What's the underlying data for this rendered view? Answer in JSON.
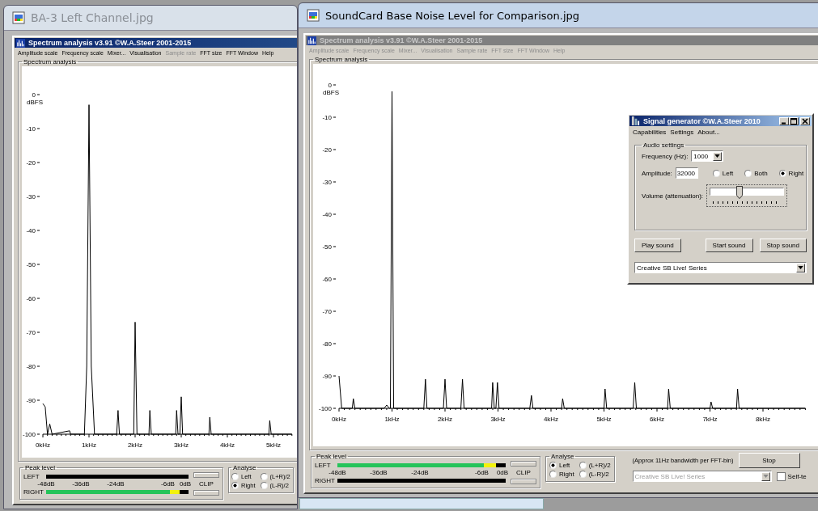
{
  "windows": [
    {
      "title": "BA-3 Left Channel.jpg",
      "active": false,
      "app": {
        "title": "Spectrum analysis v3.91  ©W.A.Steer 2001-2015",
        "active": true,
        "menu": [
          {
            "label": "Amplitude scale",
            "disabled": false
          },
          {
            "label": "Frequency scale",
            "disabled": false
          },
          {
            "label": "Mixer...",
            "disabled": false
          },
          {
            "label": "Visualisation",
            "disabled": false
          },
          {
            "label": "Sample rate",
            "disabled": true
          },
          {
            "label": "FFT size",
            "disabled": false
          },
          {
            "label": "FFT Window",
            "disabled": false
          },
          {
            "label": "Help",
            "disabled": false
          }
        ],
        "group_label": "Spectrum analysis",
        "chart_data": {
          "type": "line",
          "ylabel": "dBFS",
          "xlim": [
            0,
            5.4
          ],
          "ylim": [
            -100,
            0
          ],
          "xticks": [
            {
              "value": 0,
              "label": "0kHz"
            },
            {
              "value": 1,
              "label": "1kHz"
            },
            {
              "value": 2,
              "label": "2kHz"
            },
            {
              "value": 3,
              "label": "3kHz"
            },
            {
              "value": 4,
              "label": "4kHz"
            },
            {
              "value": 5,
              "label": "5kHz"
            }
          ],
          "yticks": [
            {
              "value": 0,
              "label": "0"
            },
            {
              "value": -10,
              "label": "-10"
            },
            {
              "value": -20,
              "label": "-20"
            },
            {
              "value": -30,
              "label": "-30"
            },
            {
              "value": -40,
              "label": "-40"
            },
            {
              "value": -50,
              "label": "-50"
            },
            {
              "value": -60,
              "label": "-60"
            },
            {
              "value": -70,
              "label": "-70"
            },
            {
              "value": -80,
              "label": "-80"
            },
            {
              "value": -90,
              "label": "-90"
            },
            {
              "value": -100,
              "label": "-100"
            }
          ],
          "x": [
            0,
            0.05,
            0.1,
            0.15,
            0.2,
            0.58,
            0.6,
            0.9,
            0.95,
            1.0,
            1.05,
            1.12,
            1.6,
            1.63,
            1.66,
            1.97,
            2.0,
            2.04,
            2.3,
            2.32,
            2.35,
            2.88,
            2.9,
            2.93,
            2.97,
            3.0,
            3.03,
            3.6,
            3.62,
            3.65,
            4.9,
            4.92,
            4.95,
            5.4
          ],
          "series": [
            {
              "color": "#000000",
              "values": [
                -91,
                -92,
                -100,
                -97,
                -100,
                -99,
                -100,
                -100,
                -80,
                -3,
                -80,
                -100,
                -100,
                -93,
                -100,
                -100,
                -67,
                -100,
                -100,
                -93,
                -100,
                -100,
                -93,
                -100,
                -100,
                -89,
                -100,
                -100,
                -95,
                -100,
                -100,
                -96,
                -100,
                -100
              ]
            }
          ]
        },
        "peak_level": {
          "label": "Peak level",
          "meters": [
            {
              "name": "LEFT",
              "level": 0
            },
            {
              "name": "RIGHT",
              "level": 0.94
            }
          ],
          "scale": [
            "-48dB",
            "-36dB",
            "-24dB",
            "-6dB",
            "0dB"
          ],
          "clip_button": "CLIP"
        },
        "analyse": {
          "label": "Analyse",
          "options": [
            {
              "label": "Left",
              "selected": false
            },
            {
              "label": "Right",
              "selected": true
            },
            {
              "label": "(L+R)/2",
              "selected": false
            },
            {
              "label": "(L-R)/2",
              "selected": false
            }
          ]
        }
      }
    },
    {
      "title": "SoundCard Base Noise Level for Comparison.jpg",
      "active": true,
      "app": {
        "title": "Spectrum analysis v3.91  ©W.A.Steer 2001-2015",
        "active": false,
        "menu": [
          {
            "label": "Amplitude scale",
            "disabled": true
          },
          {
            "label": "Frequency scale",
            "disabled": true
          },
          {
            "label": "Mixer...",
            "disabled": true
          },
          {
            "label": "Visualisation",
            "disabled": true
          },
          {
            "label": "Sample rate",
            "disabled": true
          },
          {
            "label": "FFT size",
            "disabled": true
          },
          {
            "label": "FFT Window",
            "disabled": true
          },
          {
            "label": "Help",
            "disabled": true
          }
        ],
        "group_label": "Spectrum analysis",
        "chart_data": {
          "type": "line",
          "ylabel": "dBFS",
          "xlim": [
            0,
            8.8
          ],
          "ylim": [
            -100,
            0
          ],
          "xticks": [
            {
              "value": 0,
              "label": "0kHz"
            },
            {
              "value": 1,
              "label": "1kHz"
            },
            {
              "value": 2,
              "label": "2kHz"
            },
            {
              "value": 3,
              "label": "3kHz"
            },
            {
              "value": 4,
              "label": "4kHz"
            },
            {
              "value": 5,
              "label": "5kHz"
            },
            {
              "value": 6,
              "label": "6kHz"
            },
            {
              "value": 7,
              "label": "7kHz"
            },
            {
              "value": 8,
              "label": "8kHz"
            }
          ],
          "yticks": [
            {
              "value": 0,
              "label": "0"
            },
            {
              "value": -10,
              "label": "-10"
            },
            {
              "value": -20,
              "label": "-20"
            },
            {
              "value": -30,
              "label": "-30"
            },
            {
              "value": -40,
              "label": "-40"
            },
            {
              "value": -50,
              "label": "-50"
            },
            {
              "value": -60,
              "label": "-60"
            },
            {
              "value": -70,
              "label": "-70"
            },
            {
              "value": -80,
              "label": "-80"
            },
            {
              "value": -90,
              "label": "-90"
            },
            {
              "value": -100,
              "label": "-100"
            }
          ],
          "x": [
            0,
            0.05,
            0.25,
            0.27,
            0.3,
            0.85,
            0.9,
            0.95,
            0.97,
            1.0,
            1.03,
            1.1,
            1.6,
            1.63,
            1.66,
            1.97,
            2.0,
            2.03,
            2.3,
            2.33,
            2.36,
            2.88,
            2.9,
            2.93,
            2.96,
            2.99,
            3.02,
            3.6,
            3.63,
            3.66,
            4.2,
            4.22,
            4.25,
            5.0,
            5.02,
            5.05,
            5.55,
            5.58,
            5.61,
            6.2,
            6.22,
            6.25,
            7.0,
            7.02,
            7.05,
            7.5,
            7.52,
            7.55,
            8.8
          ],
          "series": [
            {
              "color": "#000000",
              "values": [
                -90,
                -100,
                -100,
                -97,
                -100,
                -100,
                -99,
                -100,
                -100,
                -2,
                -100,
                -100,
                -100,
                -91,
                -100,
                -100,
                -91,
                -100,
                -100,
                -91,
                -100,
                -100,
                -92,
                -100,
                -100,
                -92,
                -100,
                -100,
                -96,
                -100,
                -100,
                -97,
                -100,
                -100,
                -94,
                -100,
                -100,
                -92,
                -100,
                -100,
                -94,
                -100,
                -100,
                -98,
                -100,
                -100,
                -94,
                -100,
                -100
              ]
            }
          ]
        },
        "peak_level": {
          "label": "Peak level",
          "meters": [
            {
              "name": "LEFT",
              "level": 0.94
            },
            {
              "name": "RIGHT",
              "level": 0
            }
          ],
          "scale": [
            "-48dB",
            "-36dB",
            "-24dB",
            "-6dB",
            "0dB"
          ],
          "clip_button": "CLIP"
        },
        "analyse": {
          "label": "Analyse",
          "options": [
            {
              "label": "Left",
              "selected": true
            },
            {
              "label": "Right",
              "selected": false
            },
            {
              "label": "(L+R)/2",
              "selected": false
            },
            {
              "label": "(L-R)/2",
              "selected": false
            }
          ]
        },
        "controls": {
          "note": "(Approx 11Hz bandwidth per FFT-bin)",
          "stop_button": "Stop",
          "device": {
            "value": "Creative SB Live! Series",
            "disabled": true
          },
          "self_test": {
            "label": "Self-te",
            "checked": false
          }
        }
      }
    }
  ],
  "signal_generator": {
    "title": "Signal generator  ©W.A.Steer 2010",
    "menu": [
      "Capabilities",
      "Settings",
      "About..."
    ],
    "group_label": "Audio settings",
    "frequency": {
      "label": "Frequency (Hz):",
      "value": "1000"
    },
    "amplitude": {
      "label": "Amplitude:",
      "value": "32000"
    },
    "channels": [
      {
        "label": "Left",
        "selected": false
      },
      {
        "label": "Both",
        "selected": false
      },
      {
        "label": "Right",
        "selected": true
      }
    ],
    "volume": {
      "label": "Volume (attenuation):",
      "level": 0.4
    },
    "buttons": [
      "Play sound",
      "Start sound",
      "Stop sound"
    ],
    "device": "Creative SB Live! Series"
  }
}
